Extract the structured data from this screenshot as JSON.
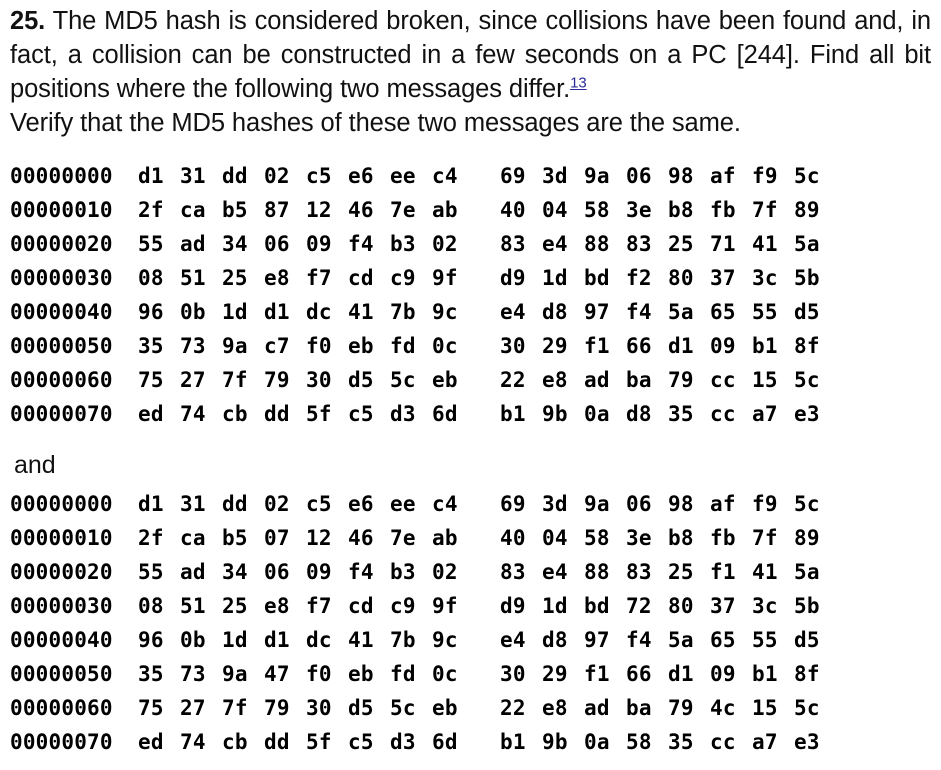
{
  "exercise": {
    "number": "25.",
    "text_line_1": "The MD5 hash is considered broken, since collisions have been found",
    "text_line_2": "and, in fact, a collision can be constructed in a few seconds on a PC",
    "text_line_3": "[244]. Find all bit positions where the following two messages differ.",
    "footnote_marker": "13",
    "text_line_4": "Verify that the MD5 hashes of these two messages are the same.",
    "full_text": "25. The MD5 hash is considered broken, since collisions have been found and, in fact, a collision can be constructed in a few seconds on a PC [244]. Find all bit positions where the following two messages differ.13 Verify that the MD5 hashes of these two messages are the same.",
    "link_color": "#2b2b9e"
  },
  "separator": {
    "label": "and"
  },
  "message_one": {
    "rows": [
      {
        "offset": "00000000",
        "left": [
          "d1",
          "31",
          "dd",
          "02",
          "c5",
          "e6",
          "ee",
          "c4"
        ],
        "right": [
          "69",
          "3d",
          "9a",
          "06",
          "98",
          "af",
          "f9",
          "5c"
        ]
      },
      {
        "offset": "00000010",
        "left": [
          "2f",
          "ca",
          "b5",
          "87",
          "12",
          "46",
          "7e",
          "ab"
        ],
        "right": [
          "40",
          "04",
          "58",
          "3e",
          "b8",
          "fb",
          "7f",
          "89"
        ]
      },
      {
        "offset": "00000020",
        "left": [
          "55",
          "ad",
          "34",
          "06",
          "09",
          "f4",
          "b3",
          "02"
        ],
        "right": [
          "83",
          "e4",
          "88",
          "83",
          "25",
          "71",
          "41",
          "5a"
        ]
      },
      {
        "offset": "00000030",
        "left": [
          "08",
          "51",
          "25",
          "e8",
          "f7",
          "cd",
          "c9",
          "9f"
        ],
        "right": [
          "d9",
          "1d",
          "bd",
          "f2",
          "80",
          "37",
          "3c",
          "5b"
        ]
      },
      {
        "offset": "00000040",
        "left": [
          "96",
          "0b",
          "1d",
          "d1",
          "dc",
          "41",
          "7b",
          "9c"
        ],
        "right": [
          "e4",
          "d8",
          "97",
          "f4",
          "5a",
          "65",
          "55",
          "d5"
        ]
      },
      {
        "offset": "00000050",
        "left": [
          "35",
          "73",
          "9a",
          "c7",
          "f0",
          "eb",
          "fd",
          "0c"
        ],
        "right": [
          "30",
          "29",
          "f1",
          "66",
          "d1",
          "09",
          "b1",
          "8f"
        ]
      },
      {
        "offset": "00000060",
        "left": [
          "75",
          "27",
          "7f",
          "79",
          "30",
          "d5",
          "5c",
          "eb"
        ],
        "right": [
          "22",
          "e8",
          "ad",
          "ba",
          "79",
          "cc",
          "15",
          "5c"
        ]
      },
      {
        "offset": "00000070",
        "left": [
          "ed",
          "74",
          "cb",
          "dd",
          "5f",
          "c5",
          "d3",
          "6d"
        ],
        "right": [
          "b1",
          "9b",
          "0a",
          "d8",
          "35",
          "cc",
          "a7",
          "e3"
        ]
      }
    ]
  },
  "message_two": {
    "rows": [
      {
        "offset": "00000000",
        "left": [
          "d1",
          "31",
          "dd",
          "02",
          "c5",
          "e6",
          "ee",
          "c4"
        ],
        "right": [
          "69",
          "3d",
          "9a",
          "06",
          "98",
          "af",
          "f9",
          "5c"
        ]
      },
      {
        "offset": "00000010",
        "left": [
          "2f",
          "ca",
          "b5",
          "07",
          "12",
          "46",
          "7e",
          "ab"
        ],
        "right": [
          "40",
          "04",
          "58",
          "3e",
          "b8",
          "fb",
          "7f",
          "89"
        ]
      },
      {
        "offset": "00000020",
        "left": [
          "55",
          "ad",
          "34",
          "06",
          "09",
          "f4",
          "b3",
          "02"
        ],
        "right": [
          "83",
          "e4",
          "88",
          "83",
          "25",
          "f1",
          "41",
          "5a"
        ]
      },
      {
        "offset": "00000030",
        "left": [
          "08",
          "51",
          "25",
          "e8",
          "f7",
          "cd",
          "c9",
          "9f"
        ],
        "right": [
          "d9",
          "1d",
          "bd",
          "72",
          "80",
          "37",
          "3c",
          "5b"
        ]
      },
      {
        "offset": "00000040",
        "left": [
          "96",
          "0b",
          "1d",
          "d1",
          "dc",
          "41",
          "7b",
          "9c"
        ],
        "right": [
          "e4",
          "d8",
          "97",
          "f4",
          "5a",
          "65",
          "55",
          "d5"
        ]
      },
      {
        "offset": "00000050",
        "left": [
          "35",
          "73",
          "9a",
          "47",
          "f0",
          "eb",
          "fd",
          "0c"
        ],
        "right": [
          "30",
          "29",
          "f1",
          "66",
          "d1",
          "09",
          "b1",
          "8f"
        ]
      },
      {
        "offset": "00000060",
        "left": [
          "75",
          "27",
          "7f",
          "79",
          "30",
          "d5",
          "5c",
          "eb"
        ],
        "right": [
          "22",
          "e8",
          "ad",
          "ba",
          "79",
          "4c",
          "15",
          "5c"
        ]
      },
      {
        "offset": "00000070",
        "left": [
          "ed",
          "74",
          "cb",
          "dd",
          "5f",
          "c5",
          "d3",
          "6d"
        ],
        "right": [
          "b1",
          "9b",
          "0a",
          "58",
          "35",
          "cc",
          "a7",
          "e3"
        ]
      }
    ]
  }
}
